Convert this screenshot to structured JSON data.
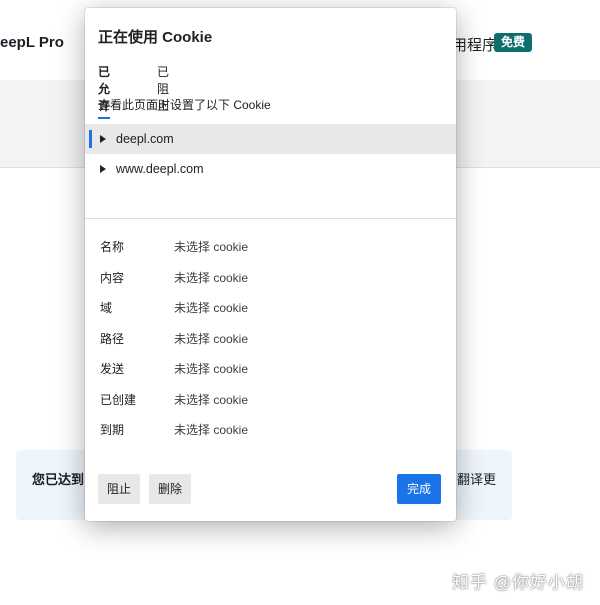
{
  "background": {
    "brand_text": "eepL Pro",
    "apps_text": "用程序",
    "badge_text": "免费",
    "notice_left": "您已达到",
    "notice_right": "翻译更",
    "watermark": "知乎 @你好小胡"
  },
  "dialog": {
    "title": "正在使用 Cookie",
    "tabs": [
      {
        "label": "已允许",
        "active": true
      },
      {
        "label": "已阻止",
        "active": false
      }
    ],
    "subtitle": "查看此页面时设置了以下 Cookie",
    "sites": [
      {
        "label": "deepl.com",
        "selected": true
      },
      {
        "label": "www.deepl.com",
        "selected": false
      }
    ],
    "details": [
      {
        "label": "名称",
        "value": "未选择 cookie"
      },
      {
        "label": "内容",
        "value": "未选择 cookie"
      },
      {
        "label": "域",
        "value": "未选择 cookie"
      },
      {
        "label": "路径",
        "value": "未选择 cookie"
      },
      {
        "label": "发送",
        "value": "未选择 cookie"
      },
      {
        "label": "已创建",
        "value": "未选择 cookie"
      },
      {
        "label": "到期",
        "value": "未选择 cookie"
      }
    ],
    "buttons": {
      "block": "阻止",
      "delete": "删除",
      "done": "完成"
    }
  },
  "colors": {
    "accent": "#1a73e8",
    "badge": "#0f6f6f",
    "notice_bg": "#eef5fb"
  }
}
